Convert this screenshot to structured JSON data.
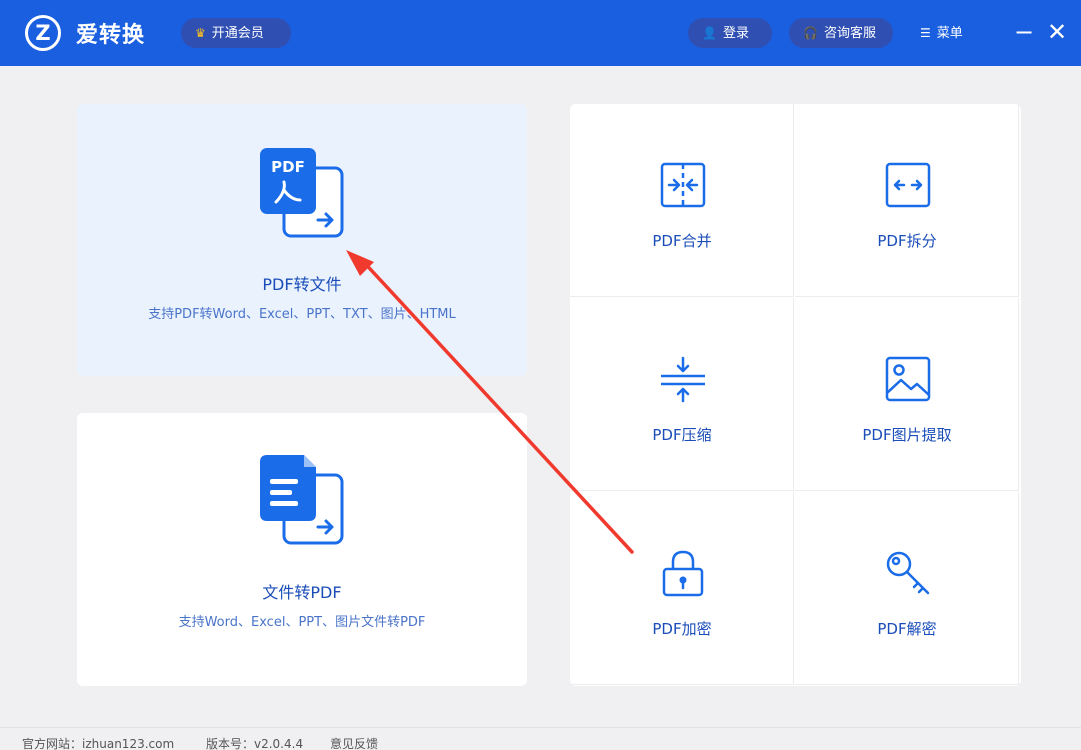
{
  "app": {
    "logo_letter": "Z",
    "title": "爱转换",
    "vip_label": "开通会员",
    "login_label": "登录",
    "service_label": "咨询客服",
    "menu_label": "菜单",
    "minimize_glyph": "−",
    "close_glyph": "✕"
  },
  "cards": {
    "pdf_to_file": {
      "title": "PDF转文件",
      "subtitle": "支持PDF转Word、Excel、PPT、TXT、图片、HTML",
      "icon_text": "PDF"
    },
    "file_to_pdf": {
      "title": "文件转PDF",
      "subtitle": "支持Word、Excel、PPT、图片文件转PDF"
    }
  },
  "tools": [
    {
      "label": "PDF合并",
      "icon": "merge-icon"
    },
    {
      "label": "PDF拆分",
      "icon": "split-icon"
    },
    {
      "label": "PDF压缩",
      "icon": "compress-icon"
    },
    {
      "label": "PDF图片提取",
      "icon": "image-extract-icon"
    },
    {
      "label": "PDF加密",
      "icon": "lock-icon"
    },
    {
      "label": "PDF解密",
      "icon": "key-icon"
    }
  ],
  "footer": {
    "website": "官方网站：izhuan123.com",
    "version": "版本号：v2.0.4.4",
    "feedback": "意见反馈"
  },
  "colors": {
    "titlebar": "#1a5fe0",
    "accent": "#1a6ce8",
    "annotation_arrow": "#f03a2e"
  }
}
